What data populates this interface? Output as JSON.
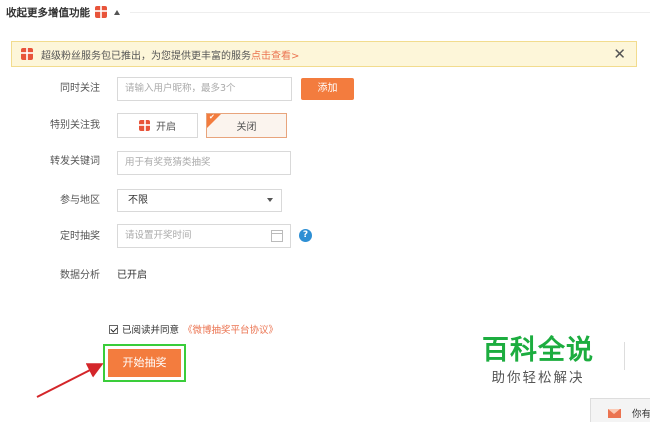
{
  "header": {
    "collapse_label": "收起更多增值功能"
  },
  "notice": {
    "text": "超级粉丝服务包已推出，为您提供更丰富的服务",
    "link": "点击查看>",
    "close_glyph": "✕"
  },
  "form": {
    "follow": {
      "label": "同时关注",
      "placeholder": "请输入用户昵称，最多3个",
      "add_button": "添加"
    },
    "special_follow": {
      "label": "特别关注我",
      "on_label": "开启",
      "off_label": "关闭",
      "selected": "关闭"
    },
    "repost_keyword": {
      "label": "转发关键词",
      "placeholder": "用于有奖竞猜类抽奖"
    },
    "region": {
      "label": "参与地区",
      "selected": "不限"
    },
    "scheduled_draw": {
      "label": "定时抽奖",
      "placeholder": "请设置开奖时间",
      "help_glyph": "?"
    },
    "data_analysis": {
      "label": "数据分析",
      "value": "已开启"
    }
  },
  "agreement": {
    "checked": true,
    "text": "已阅读并同意",
    "link": "《微博抽奖平台协议》"
  },
  "start_button": "开始抽奖",
  "watermark": {
    "title": "百科全说",
    "subtitle": "助你轻松解决"
  },
  "chat_tab": {
    "text": "你有"
  },
  "colors": {
    "accent": "#f37c3e",
    "link": "#eb7350",
    "highlight": "#3acd3a",
    "watermark": "#1cad3f",
    "help": "#2d8fd4",
    "arrow": "#d4262a"
  }
}
